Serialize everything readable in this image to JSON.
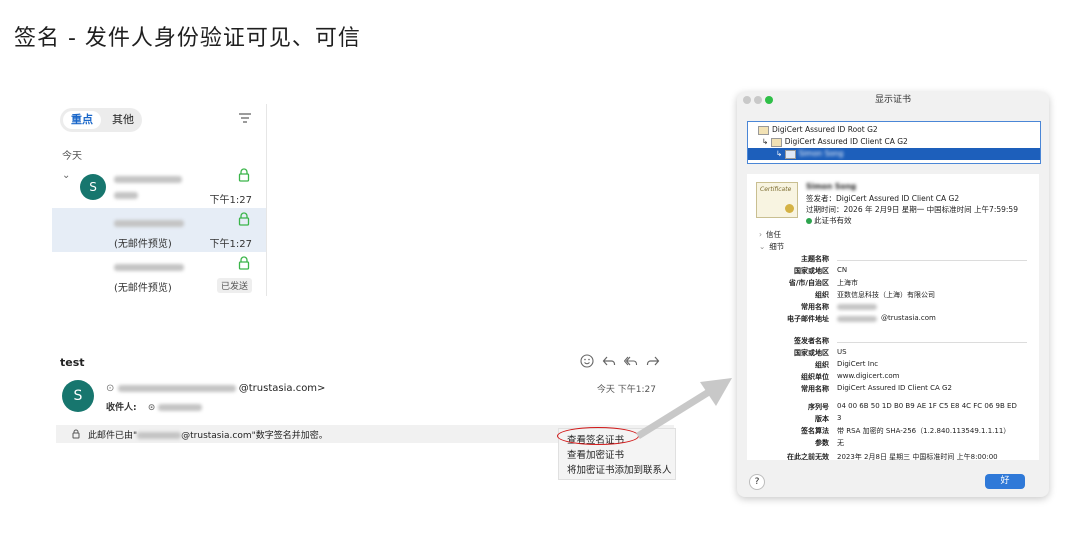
{
  "slide": {
    "title": "签名 - 发件人身份验证可见、可信"
  },
  "mail_list": {
    "tabs": [
      {
        "label": "重点"
      },
      {
        "label": "其他"
      }
    ],
    "date_header": "今天",
    "rows": [
      {
        "avatar_letter": "S",
        "preview": "",
        "status": "下午1:27"
      },
      {
        "avatar_letter": "",
        "preview": "(无邮件预览)",
        "status": "下午1:27"
      },
      {
        "avatar_letter": "",
        "preview": "(无邮件预览)",
        "status": "已发送"
      }
    ]
  },
  "message": {
    "subject": "test",
    "avatar_letter": "S",
    "from_suffix": "@trustasia.com>",
    "recipient_label": "收件人:",
    "time": "今天 下午1:27",
    "banner_prefix": "此邮件已由\"",
    "banner_suffix": "@trustasia.com\"数字签名并加密。"
  },
  "context_menu": {
    "items": [
      "查看签名证书",
      "查看加密证书",
      "将加密证书添加到联系人"
    ]
  },
  "cert_dialog": {
    "title": "显示证书",
    "chain": [
      {
        "label": "DigiCert Assured ID Root G2"
      },
      {
        "label": "DigiCert Assured ID Client CA G2"
      },
      {
        "label": "Simon Song"
      }
    ],
    "subject_name": "Simon Song",
    "issuer_line": "签发者：DigiCert Assured ID Client CA G2",
    "expiry_line": "过期时间：2026 年 2月9日 星期一 中国标准时间 上午7:59:59",
    "valid_text": "此证书有效",
    "sections": [
      "信任",
      "细节"
    ],
    "subject_fields": [
      {
        "k": "主题名称",
        "v": ""
      },
      {
        "k": "国家或地区",
        "v": "CN"
      },
      {
        "k": "省/市/自治区",
        "v": "上海市"
      },
      {
        "k": "组织",
        "v": "亚数信息科技（上海）有限公司"
      },
      {
        "k": "常用名称",
        "v": ""
      },
      {
        "k": "电子邮件地址",
        "v": "@trustasia.com"
      }
    ],
    "issuer_fields": [
      {
        "k": "签发者名称",
        "v": ""
      },
      {
        "k": "国家或地区",
        "v": "US"
      },
      {
        "k": "组织",
        "v": "DigiCert Inc"
      },
      {
        "k": "组织单位",
        "v": "www.digicert.com"
      },
      {
        "k": "常用名称",
        "v": "DigiCert Assured ID Client CA G2"
      }
    ],
    "misc_fields": [
      {
        "k": "序列号",
        "v": "04 00 6B 50 1D B0 B9 AE 1F C5 E8 4C FC 06 9B ED"
      },
      {
        "k": "版本",
        "v": "3"
      },
      {
        "k": "签名算法",
        "v": "带 RSA 加密的 SHA-256（1.2.840.113549.1.1.11）"
      },
      {
        "k": "参数",
        "v": "无"
      }
    ],
    "not_before": {
      "k": "在此之前无效",
      "v": "2023年 2月8日 星期三 中国标准时间 上午8:00:00"
    },
    "help_label": "?",
    "ok_label": "好"
  },
  "colors": {
    "accent": "#1d5fbb",
    "avatar": "#17766e",
    "highlight_oval": "#d21a1a"
  }
}
